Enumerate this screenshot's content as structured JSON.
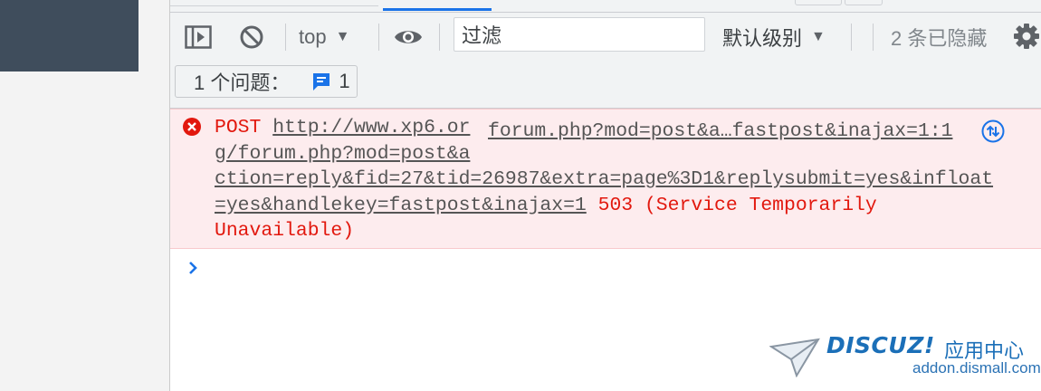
{
  "console": {
    "toolbar": {
      "context_selector": "top",
      "filter_placeholder": "过滤",
      "filter_value": "过滤",
      "log_level": "默认级别",
      "hidden_count_label": "2 条已隐藏"
    },
    "issues": {
      "label": "1 个问题：",
      "count": "1"
    },
    "messages": [
      {
        "level": "error",
        "method": "POST",
        "url": "http://www.xp6.org/forum.php?mod=post&action=reply&fid=27&tid=26987&extra=page%3D1&replysubmit=yes&infloat=yes&handlekey=fastpost&inajax=1",
        "url_lines": [
          "http://www.xp6.or",
          "g/forum.php?mod=post&a",
          "ction=reply&fid=27&tid=26987&extra=page%3D1&replysubmit=yes&infloat",
          "=yes&handlekey=fastpost&inajax=1"
        ],
        "status": "503 (Service Temporarily",
        "status_tail": "Unavailable)",
        "source_link": "forum.php?mod=post&a…fastpost&inajax=1:1"
      }
    ]
  },
  "watermark": {
    "logo_text": "DISCUZ!",
    "logo_cn": "应用中心",
    "domain": "addon.dismall.com"
  },
  "colors": {
    "error_text": "#e2180e",
    "error_bg": "#fdecee",
    "accent": "#1a73e8",
    "toolbar_bg": "#f1f3f4"
  }
}
